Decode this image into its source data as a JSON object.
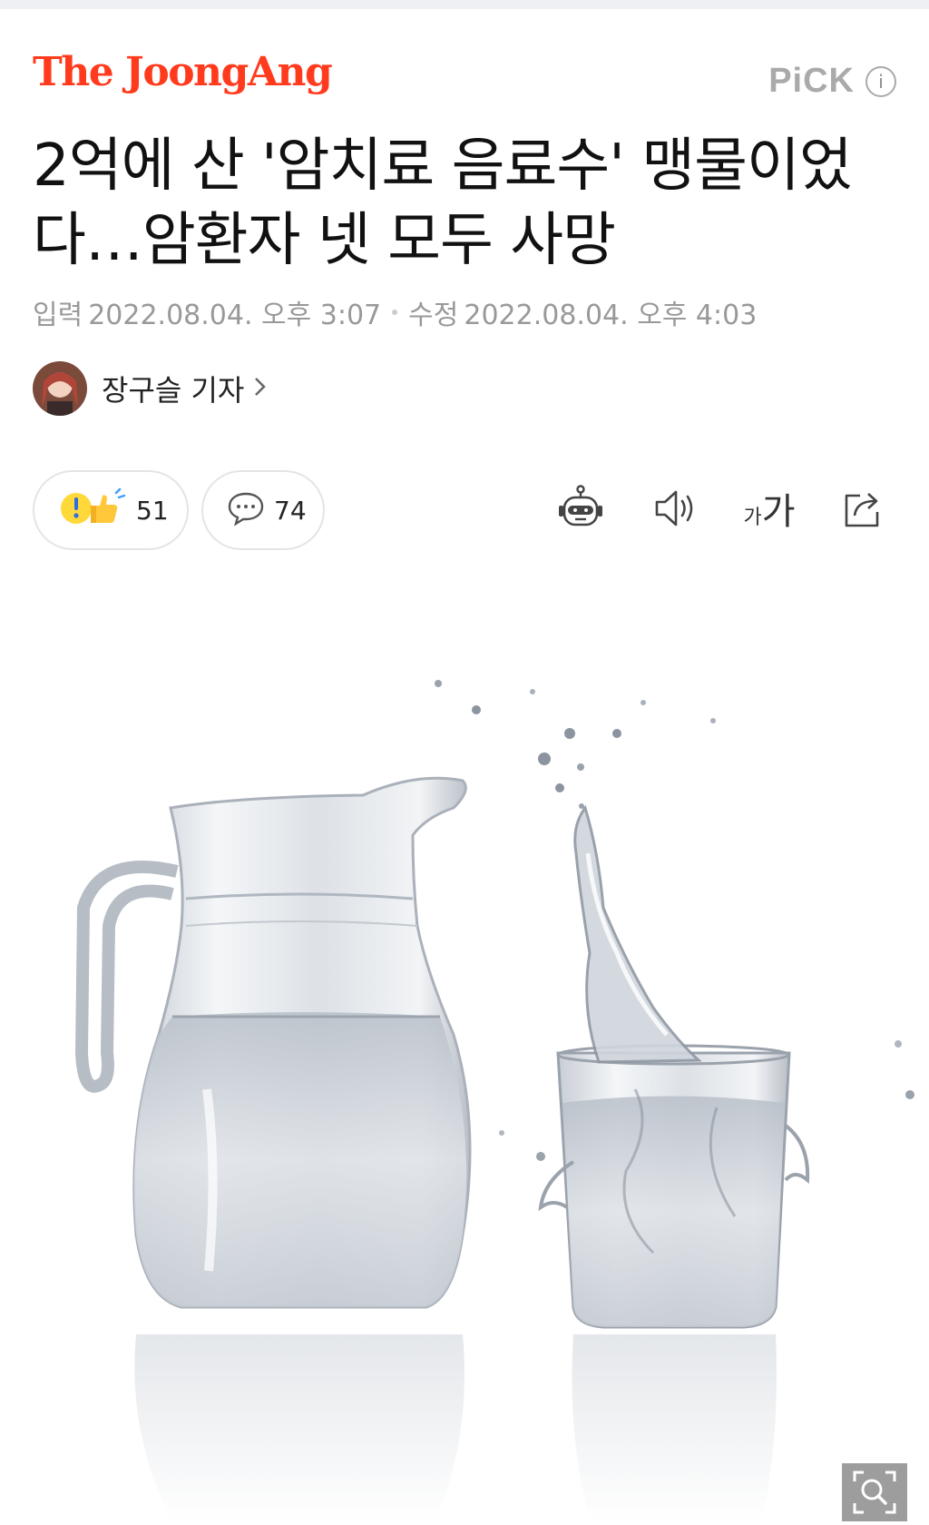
{
  "header": {
    "brand": "The JoongAng",
    "pick_label": "PiCK",
    "pick_info_icon": "info-icon",
    "pick_info_text": "i"
  },
  "article": {
    "title": "2억에 산 '암치료 음료수' 맹물이었다…암환자 넷 모두 사망",
    "input_label": "입력",
    "input_time": "2022.08.04. 오후 3:07",
    "modified_label": "수정",
    "modified_time": "2022.08.04. 오후 4:03"
  },
  "reporter": {
    "name": "장구슬 기자",
    "avatar_icon": "reporter-avatar"
  },
  "actions": {
    "reaction_count": "51",
    "comment_count": "74",
    "fontsize_small": "가",
    "fontsize_large": "가"
  },
  "toolbar_icons": [
    "summary-bot-icon",
    "speaker-icon",
    "font-size-icon",
    "share-icon"
  ],
  "media": {
    "description_icon": "photo-water-pitcher-and-glass",
    "zoom_icon": "zoom-icon"
  },
  "colors": {
    "brand": "#ff3a1d",
    "meta_gray": "#999999",
    "pick_gray": "#aaaaaa"
  }
}
